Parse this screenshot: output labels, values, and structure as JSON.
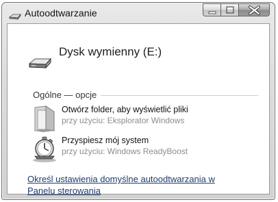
{
  "window": {
    "title": "Autoodtwarzanie",
    "icon": "cd-drive-icon",
    "controls": [
      "minimize-icon",
      "maximize-icon",
      "close-icon"
    ]
  },
  "drive": {
    "name": "Dysk wymienny (E:)",
    "icon": "removable-drive-icon"
  },
  "section": {
    "label": "Ogólne — opcje"
  },
  "options": [
    {
      "title": "Otwórz folder, aby wyświetlić pliki",
      "subtitle": "przy użyciu: Eksplorator Windows",
      "icon": "folder-icon"
    },
    {
      "title": "Przyspiesz mój system",
      "subtitle": "przy użyciu: Windows ReadyBoost",
      "icon": "stopwatch-icon"
    }
  ],
  "footer_link": {
    "line1": "Określ ustawienia domyślne autoodtwarzania w",
    "line2": "Panelu sterowania"
  }
}
